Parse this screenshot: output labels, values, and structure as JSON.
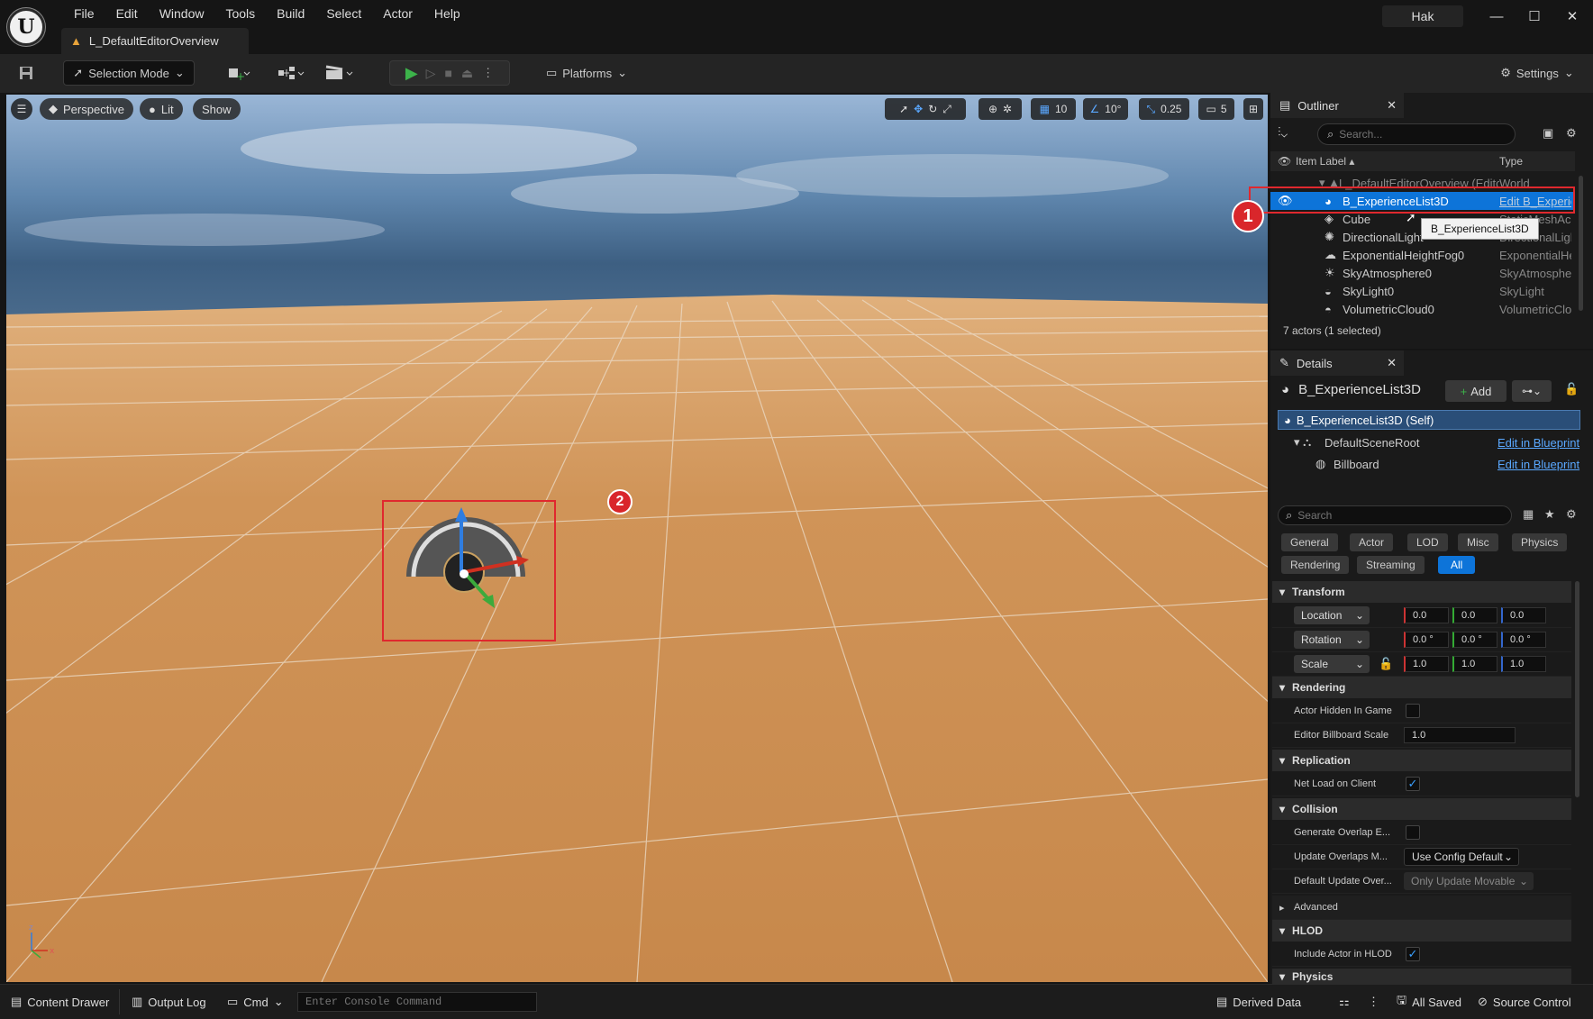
{
  "menu": [
    "File",
    "Edit",
    "Window",
    "Tools",
    "Build",
    "Select",
    "Actor",
    "Help"
  ],
  "document_tab": "L_DefaultEditorOverview",
  "user": "Hak",
  "toolbar": {
    "selection_mode": "Selection Mode",
    "platforms": "Platforms",
    "settings": "Settings"
  },
  "viewport": {
    "perspective": "Perspective",
    "lit": "Lit",
    "show": "Show",
    "grid_snap": "10",
    "rot_snap": "10°",
    "scale_snap": "0.25",
    "camera_speed": "5",
    "badge1": "1",
    "badge2": "2"
  },
  "outliner": {
    "title": "Outliner",
    "search_placeholder": "Search...",
    "col_label": "Item Label ▴",
    "col_type": "Type",
    "items": [
      {
        "label": "L_DefaultEditorOverview (Edito",
        "type": "World"
      },
      {
        "label": "B_ExperienceList3D",
        "type": "Edit B_Experie"
      },
      {
        "label": "Cube",
        "type": "StaticMeshAc"
      },
      {
        "label": "DirectionalLight",
        "type": "DirectionalLigh"
      },
      {
        "label": "ExponentialHeightFog0",
        "type": "ExponentialHe"
      },
      {
        "label": "SkyAtmosphere0",
        "type": "SkyAtmosphe"
      },
      {
        "label": "SkyLight0",
        "type": "SkyLight"
      },
      {
        "label": "VolumetricCloud0",
        "type": "VolumetricClo"
      }
    ],
    "tooltip": "B_ExperienceList3D",
    "status": "7 actors (1 selected)"
  },
  "details": {
    "title": "Details",
    "actor": "B_ExperienceList3D",
    "add": "Add",
    "components": [
      {
        "label": "B_ExperienceList3D (Self)",
        "link": ""
      },
      {
        "label": "DefaultSceneRoot",
        "link": "Edit in Blueprint"
      },
      {
        "label": "Billboard",
        "link": "Edit in Blueprint"
      }
    ],
    "search_placeholder": "Search",
    "filters1": [
      "General",
      "Actor",
      "LOD",
      "Misc",
      "Physics"
    ],
    "filters2": [
      "Rendering",
      "Streaming",
      "All"
    ],
    "transform": "Transform",
    "location": "Location",
    "rotation": "Rotation",
    "scale": "Scale",
    "loc": [
      "0.0",
      "0.0",
      "0.0"
    ],
    "rot": [
      "0.0 °",
      "0.0 °",
      "0.0 °"
    ],
    "scl": [
      "1.0",
      "1.0",
      "1.0"
    ],
    "rendering": "Rendering",
    "hidden": "Actor Hidden In Game",
    "billboard_scale": "Editor Billboard Scale",
    "billboard_value": "1.0",
    "replication": "Replication",
    "net_load": "Net Load on Client",
    "collision": "Collision",
    "gen_overlap": "Generate Overlap E...",
    "upd_overlap": "Update Overlaps M...",
    "upd_overlap_val": "Use Config Default",
    "def_update": "Default Update Over...",
    "def_update_val": "Only Update Movable",
    "advanced": "Advanced",
    "hlod": "HLOD",
    "include_hlod": "Include Actor in HLOD",
    "physics": "Physics"
  },
  "status": {
    "content_drawer": "Content Drawer",
    "output_log": "Output Log",
    "cmd": "Cmd",
    "console_placeholder": "Enter Console Command",
    "derived": "Derived Data",
    "all_saved": "All Saved",
    "source_control": "Source Control"
  },
  "colors": {
    "accent": "#0d74d9",
    "play": "#3cb34a",
    "badge": "#d9262b"
  }
}
